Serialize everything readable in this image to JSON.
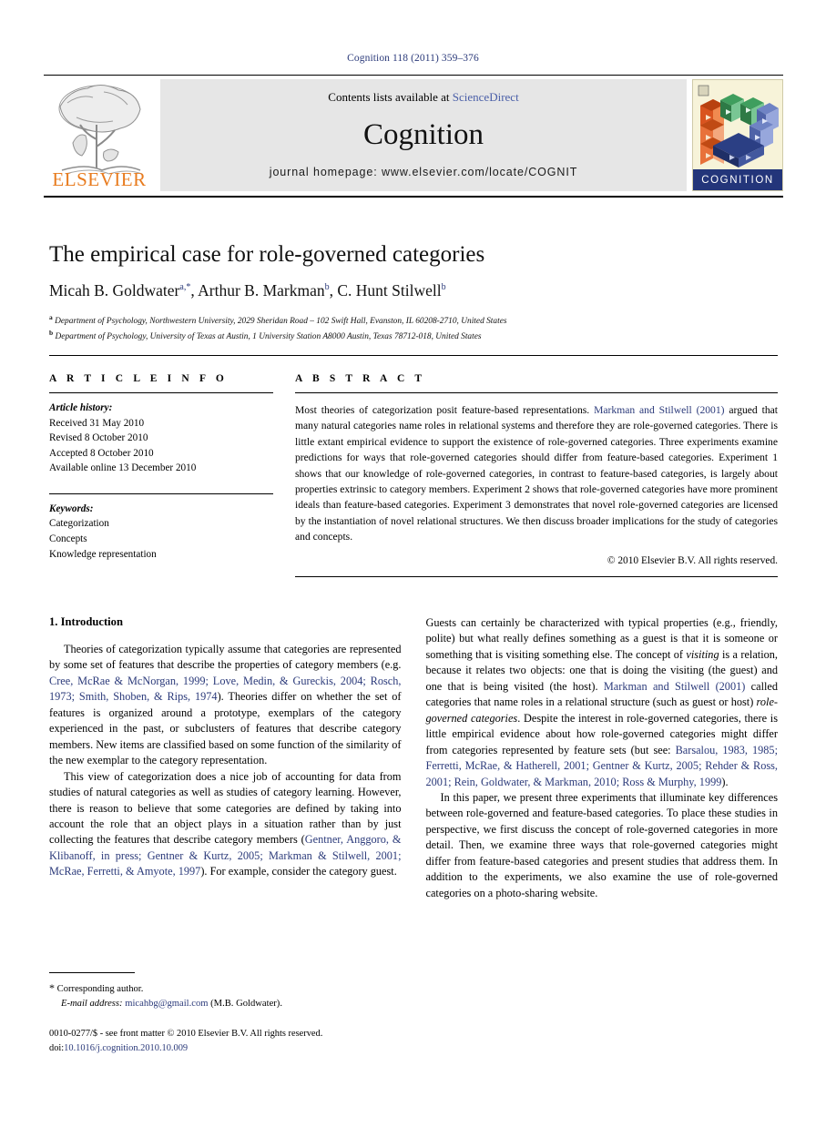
{
  "running_head": "Cognition 118 (2011) 359–376",
  "masthead": {
    "contents_prefix": "Contents lists available at ",
    "contents_link": "ScienceDirect",
    "journal_name": "Cognition",
    "homepage": "journal homepage: www.elsevier.com/locate/COGNIT",
    "publisher_wordmark": "ELSEVIER",
    "cover_label": "COGNITION",
    "link_color": "#4a5fa8",
    "elsevier_orange": "#e87b1e",
    "cover_band_blue": "#23357a"
  },
  "title": "The empirical case for role-governed categories",
  "authors": [
    {
      "name": "Micah B. Goldwater",
      "marks": "a,*"
    },
    {
      "name": "Arthur B. Markman",
      "marks": "b"
    },
    {
      "name": "C. Hunt Stilwell",
      "marks": "b"
    }
  ],
  "affiliations": [
    {
      "mark": "a",
      "text": "Department of Psychology, Northwestern University, 2029 Sheridan Road – 102 Swift Hall, Evanston, IL 60208-2710, United States"
    },
    {
      "mark": "b",
      "text": "Department of Psychology, University of Texas at Austin, 1 University Station A8000 Austin, Texas 78712-018, United States"
    }
  ],
  "article_info": {
    "heading": "A R T I C L E   I N F O",
    "history_label": "Article history:",
    "history": [
      "Received 31 May 2010",
      "Revised 8 October 2010",
      "Accepted 8 October 2010",
      "Available online 13 December 2010"
    ],
    "keywords_label": "Keywords:",
    "keywords": [
      "Categorization",
      "Concepts",
      "Knowledge representation"
    ]
  },
  "abstract": {
    "heading": "A B S T R A C T",
    "text_part_1": "Most theories of categorization posit feature-based representations. ",
    "ref_1": "Markman and Stilwell (2001)",
    "text_part_2": " argued that many natural categories name roles in relational systems and therefore they are role-governed categories. There is little extant empirical evidence to support the existence of role-governed categories. Three experiments examine predictions for ways that role-governed categories should differ from feature-based categories. Experiment 1 shows that our knowledge of role-governed categories, in contrast to feature-based categories, is largely about properties extrinsic to category members. Experiment 2 shows that role-governed categories have more prominent ideals than feature-based categories. Experiment 3 demonstrates that novel role-governed categories are licensed by the instantiation of novel relational structures. We then discuss broader implications for the study of categories and concepts.",
    "copyright": "© 2010 Elsevier B.V. All rights reserved."
  },
  "body": {
    "section_1_title": "1. Introduction",
    "left": {
      "p1_a": "Theories of categorization typically assume that categories are represented by some set of features that describe the properties of category members (e.g. ",
      "p1_ref": "Cree, McRae & McNorgan, 1999; Love, Medin, & Gureckis, 2004; Rosch, 1973; Smith, Shoben, & Rips, 1974",
      "p1_b": "). Theories differ on whether the set of features is organized around a prototype, exemplars of the category experienced in the past, or subclusters of features that describe category members. New items are classified based on some function of the similarity of the new exemplar to the category representation.",
      "p2_a": "This view of categorization does a nice job of accounting for data from studies of natural categories as well as studies of category learning. However, there is reason to believe that some categories are defined by taking into account the role that an object plays in a situation rather than by just collecting the features that describe category members (",
      "p2_ref": "Gentner, Anggoro, & Klibanoff, in press; Gentner & Kurtz, 2005; Markman & Stilwell, 2001; McRae, Ferretti, & Amyote, 1997",
      "p2_b": "). For example, consider the category guest."
    },
    "right": {
      "p3_a": "Guests can certainly be characterized with typical properties (e.g., friendly, polite) but what really defines something as a guest is that it is someone or something that is visiting something else. The concept of ",
      "p3_italic_1": "visiting",
      "p3_b": " is a relation, because it relates two objects: one that is doing the visiting (the guest) and one that is being visited (the host). ",
      "p3_ref": "Markman and Stilwell (2001)",
      "p3_c": " called categories that name roles in a relational structure (such as guest or host) ",
      "p3_italic_2": "role-governed categories",
      "p3_d": ". Despite the interest in role-governed categories, there is little empirical evidence about how role-governed categories might differ from categories represented by feature sets (but see: ",
      "p3_ref2": "Barsalou, 1983, 1985; Ferretti, McRae, & Hatherell, 2001; Gentner & Kurtz, 2005; Rehder & Ross, 2001; Rein, Goldwater, & Markman, 2010; Ross & Murphy, 1999",
      "p3_e": ").",
      "p4": "In this paper, we present three experiments that illuminate key differences between role-governed and feature-based categories. To place these studies in perspective, we first discuss the concept of role-governed categories in more detail. Then, we examine three ways that role-governed categories might differ from feature-based categories and present studies that address them. In addition to the experiments, we also examine the use of role-governed categories on a photo-sharing website."
    }
  },
  "footnote": {
    "corresponding": "Corresponding author.",
    "email_label": "E-mail address:",
    "email": "micahbg@gmail.com",
    "email_suffix": " (M.B. Goldwater)."
  },
  "colophon": {
    "line1": "0010-0277/$ - see front matter © 2010 Elsevier B.V. All rights reserved.",
    "doi_label": "doi:",
    "doi": "10.1016/j.cognition.2010.10.009"
  }
}
